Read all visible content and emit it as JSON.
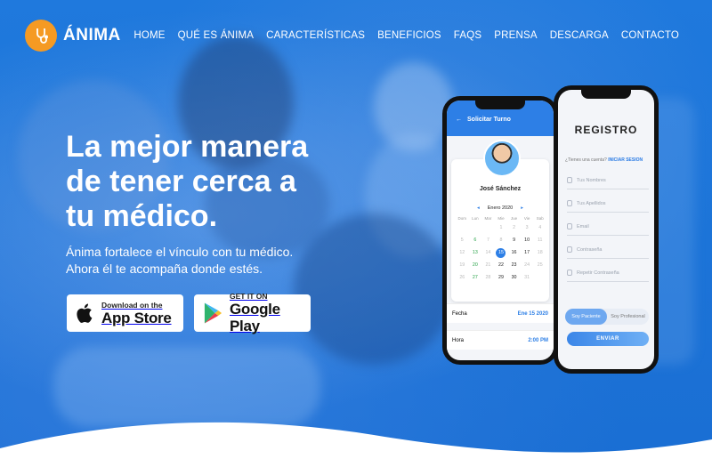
{
  "brand": {
    "name": "ÁNIMA",
    "accent": "#f59a23",
    "primary": "#1c74d8"
  },
  "nav": [
    {
      "label": "HOME",
      "key": "home"
    },
    {
      "label": "QUÉ ES ÁNIMA",
      "key": "que-es"
    },
    {
      "label": "CARACTERÍSTICAS",
      "key": "caracteristicas"
    },
    {
      "label": "BENEFICIOS",
      "key": "beneficios"
    },
    {
      "label": "FAQS",
      "key": "faqs"
    },
    {
      "label": "PRENSA",
      "key": "prensa"
    },
    {
      "label": "DESCARGA",
      "key": "descarga"
    },
    {
      "label": "CONTACTO",
      "key": "contacto"
    }
  ],
  "hero": {
    "headline_1": "La mejor manera",
    "headline_2": "de tener cerca a",
    "headline_3": "tu médico.",
    "sub_1": "Ánima fortalece el vínculo con tu médico.",
    "sub_2": "Ahora él te acompaña donde estés."
  },
  "stores": {
    "apple_small": "Download on the",
    "apple_big": "App Store",
    "google_small": "GET IT ON",
    "google_big": "Google Play"
  },
  "registro": {
    "title": "REGISTRO",
    "question": "¿Tienes una cuenta?",
    "login": "INICIAR SESION",
    "fields": [
      "Tus Nombres",
      "Tus Apellidos",
      "Email",
      "Contraseña",
      "Repetir Contraseña"
    ],
    "toggle_patient": "Soy Paciente",
    "toggle_doctor": "Soy Profesional",
    "submit": "ENVIAR"
  },
  "turno": {
    "title": "Solicitar Turno",
    "doctor": "José Sánchez",
    "month": "Enero 2020",
    "dow": [
      "Dom",
      "Lun",
      "Mar",
      "Mie",
      "Jue",
      "Vie",
      "Sab"
    ],
    "weeks": [
      [
        "",
        "",
        "",
        "1",
        "2",
        "3",
        "4"
      ],
      [
        "5",
        "6",
        "7",
        "8",
        "9",
        "10",
        "11"
      ],
      [
        "12",
        "13",
        "14",
        "15",
        "16",
        "17",
        "18"
      ],
      [
        "19",
        "20",
        "21",
        "22",
        "23",
        "24",
        "25"
      ],
      [
        "26",
        "27",
        "28",
        "29",
        "30",
        "31",
        ""
      ]
    ],
    "selected_day": "15",
    "fecha_label": "Fecha",
    "fecha_value": "Ene 15 2020",
    "hora_label": "Hora",
    "hora_value": "2:00 PM"
  }
}
